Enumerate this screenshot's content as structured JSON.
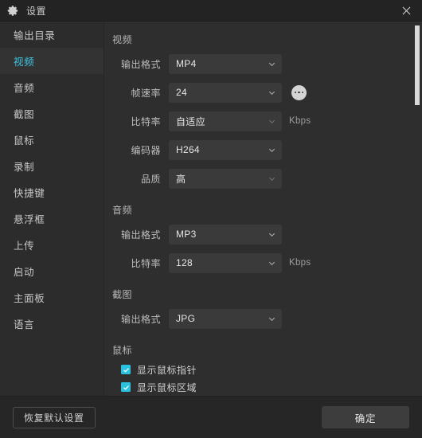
{
  "window": {
    "title": "设置",
    "gear_icon": "gear-icon",
    "close_icon": "close-icon"
  },
  "sidebar": {
    "items": [
      {
        "label": "输出目录",
        "active": false
      },
      {
        "label": "视频",
        "active": true
      },
      {
        "label": "音频",
        "active": false
      },
      {
        "label": "截图",
        "active": false
      },
      {
        "label": "鼠标",
        "active": false
      },
      {
        "label": "录制",
        "active": false
      },
      {
        "label": "快捷键",
        "active": false
      },
      {
        "label": "悬浮框",
        "active": false
      },
      {
        "label": "上传",
        "active": false
      },
      {
        "label": "启动",
        "active": false
      },
      {
        "label": "主面板",
        "active": false
      },
      {
        "label": "语言",
        "active": false
      }
    ]
  },
  "main": {
    "video": {
      "section_title": "视频",
      "output_format_label": "输出格式",
      "output_format_value": "MP4",
      "framerate_label": "帧速率",
      "framerate_value": "24",
      "framerate_more_icon": "ellipsis-icon",
      "bitrate_label": "比特率",
      "bitrate_value": "自适应",
      "bitrate_unit": "Kbps",
      "encoder_label": "编码器",
      "encoder_value": "H264",
      "quality_label": "品质",
      "quality_value": "高"
    },
    "audio": {
      "section_title": "音频",
      "output_format_label": "输出格式",
      "output_format_value": "MP3",
      "bitrate_label": "比特率",
      "bitrate_value": "128",
      "bitrate_unit": "Kbps"
    },
    "screenshot": {
      "section_title": "截图",
      "output_format_label": "输出格式",
      "output_format_value": "JPG"
    },
    "mouse": {
      "section_title": "鼠标",
      "show_cursor_label": "显示鼠标指针",
      "show_cursor_checked": true,
      "show_area_label": "显示鼠标区域",
      "show_area_checked": true
    }
  },
  "footer": {
    "reset_label": "恢复默认设置",
    "ok_label": "确定"
  },
  "colors": {
    "accent": "#3ec6e0",
    "checkbox": "#2bc0de",
    "window_bg": "#2b2b2b",
    "panel_bg": "#2e2e2e",
    "sidebar_bg": "#2c2c2c",
    "control_bg": "#3a3a3a"
  }
}
